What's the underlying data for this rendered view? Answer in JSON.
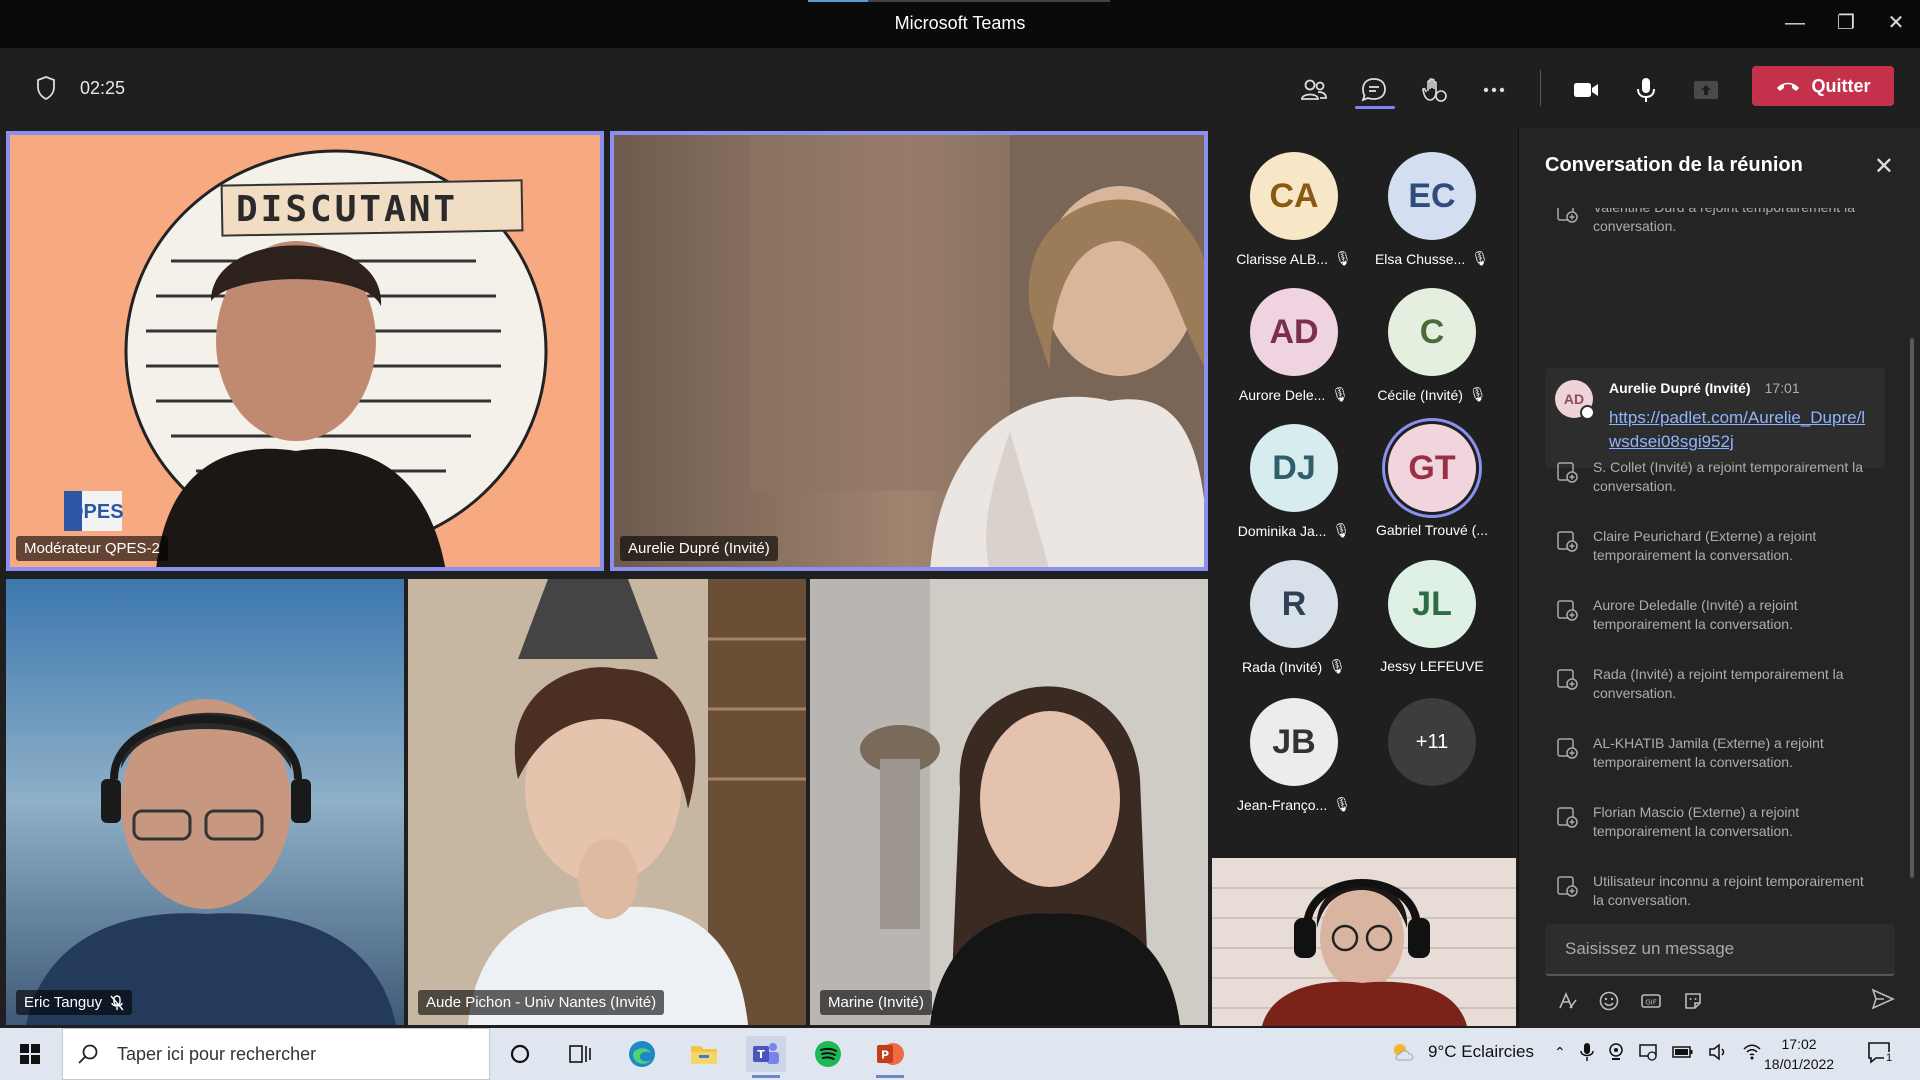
{
  "window": {
    "title": "Microsoft Teams"
  },
  "meeting": {
    "timer": "02:25",
    "leave_label": "Quitter"
  },
  "tiles": [
    {
      "name": "Modérateur QPES-2",
      "sign_text": "DISCUTANT",
      "logo_text": "QPES"
    },
    {
      "name": "Aurelie Dupré (Invité)"
    },
    {
      "name": "Eric Tanguy",
      "muted": true
    },
    {
      "name": "Aude Pichon - Univ Nantes (Invité)"
    },
    {
      "name": "Marine (Invité)"
    }
  ],
  "roster": [
    {
      "initials": "CA",
      "name": "Clarisse ALB...",
      "bg": "#f7e7c6",
      "fg": "#8a5a12",
      "muted": true
    },
    {
      "initials": "EC",
      "name": "Elsa Chusse...",
      "bg": "#d3dff0",
      "fg": "#2f4d7a",
      "muted": true
    },
    {
      "initials": "AD",
      "name": "Aurore Dele...",
      "bg": "#f0d3e0",
      "fg": "#7a2f52",
      "muted": true
    },
    {
      "initials": "C",
      "name": "Cécile (Invité)",
      "bg": "#e5efe0",
      "fg": "#4a6b3a",
      "muted": true
    },
    {
      "initials": "DJ",
      "name": "Dominika Ja...",
      "bg": "#d6ecef",
      "fg": "#2f5f6b",
      "muted": true
    },
    {
      "initials": "GT",
      "name": "Gabriel Trouvé (...",
      "bg": "#f0d6dc",
      "fg": "#9b2f45",
      "muted": false,
      "speaking": true
    },
    {
      "initials": "R",
      "name": "Rada (Invité)",
      "bg": "#d8e0ea",
      "fg": "#2f3f55",
      "muted": true
    },
    {
      "initials": "JL",
      "name": "Jessy LEFEUVE",
      "bg": "#dff0e4",
      "fg": "#2f6b44",
      "muted": false
    },
    {
      "initials": "JB",
      "name": "Jean-Franço...",
      "bg": "#ececec",
      "fg": "#333333",
      "muted": true
    },
    {
      "initials": "+11",
      "name": "",
      "bg": "#3d3d3d",
      "fg": "#ffffff",
      "muted": false
    }
  ],
  "chat": {
    "title": "Conversation de la réunion",
    "partial_top": "Valentine Durd a rejoint temporairement la conversation.",
    "message": {
      "initials": "AD",
      "author": "Aurelie Dupré (Invité)",
      "time": "17:01",
      "link": "https://padlet.com/Aurelie_Dupre/lwsdsei08sgi952j"
    },
    "events": [
      "S. Collet (Invité) a rejoint temporairement la conversation.",
      "Claire Peurichard (Externe) a rejoint temporairement la conversation.",
      "Aurore Deledalle (Invité) a rejoint temporairement la conversation.",
      "Rada (Invité) a rejoint temporairement la conversation.",
      "AL-KHATIB Jamila (Externe) a rejoint temporairement la conversation.",
      "Florian Mascio (Externe) a rejoint temporairement la conversation.",
      "Utilisateur inconnu a rejoint temporairement la conversation."
    ],
    "input_placeholder": "Saisissez un message"
  },
  "taskbar": {
    "search_placeholder": "Taper ici pour rechercher",
    "weather": "9°C  Eclaircies",
    "time": "17:02",
    "date": "18/01/2022",
    "notifications": "1"
  }
}
